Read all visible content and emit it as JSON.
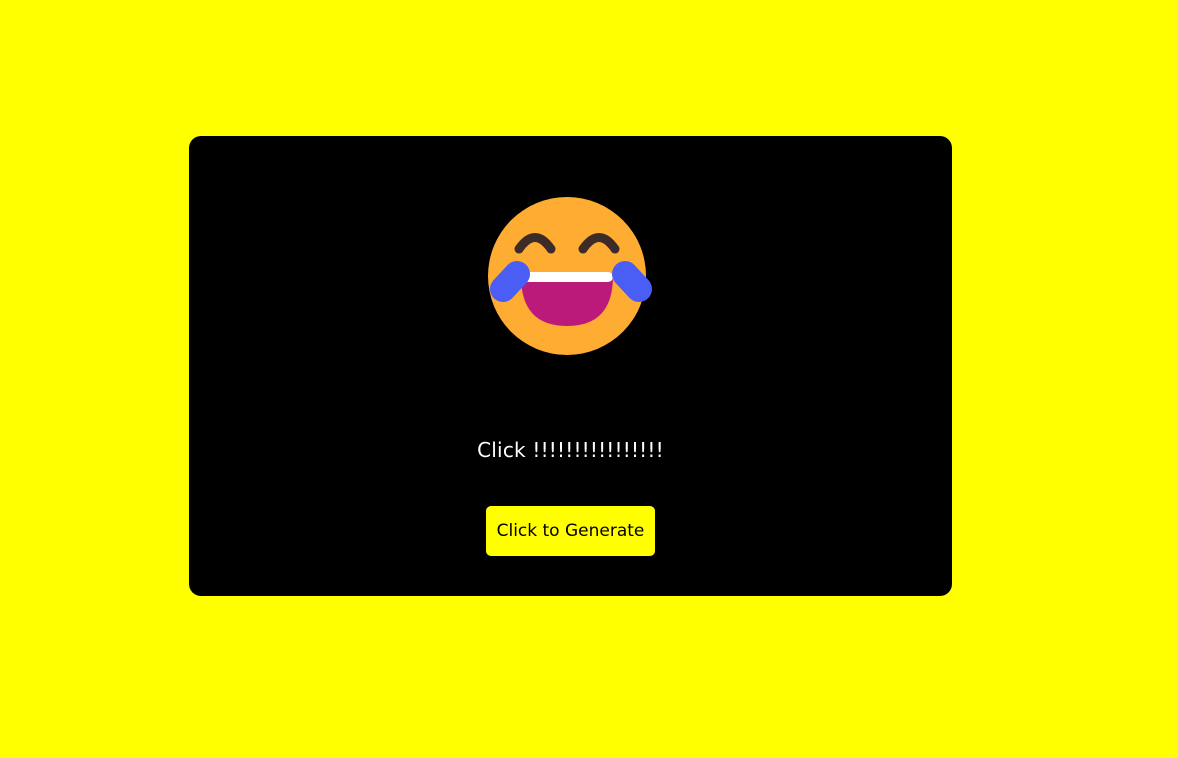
{
  "colors": {
    "page_background": "#ffff00",
    "card_background": "#000000",
    "button_background": "#ffff00",
    "button_text": "#000000",
    "caption_text": "#ffffff",
    "emoji_face": "#ffac33",
    "emoji_mouth": "#bb1a7a",
    "emoji_tears": "#4a5ef5",
    "emoji_eyes": "#3d2b28"
  },
  "emoji": {
    "icon": "face-with-tears-of-joy-icon"
  },
  "caption": {
    "text": "Click !!!!!!!!!!!!!!!!"
  },
  "button": {
    "label": "Click to Generate"
  }
}
